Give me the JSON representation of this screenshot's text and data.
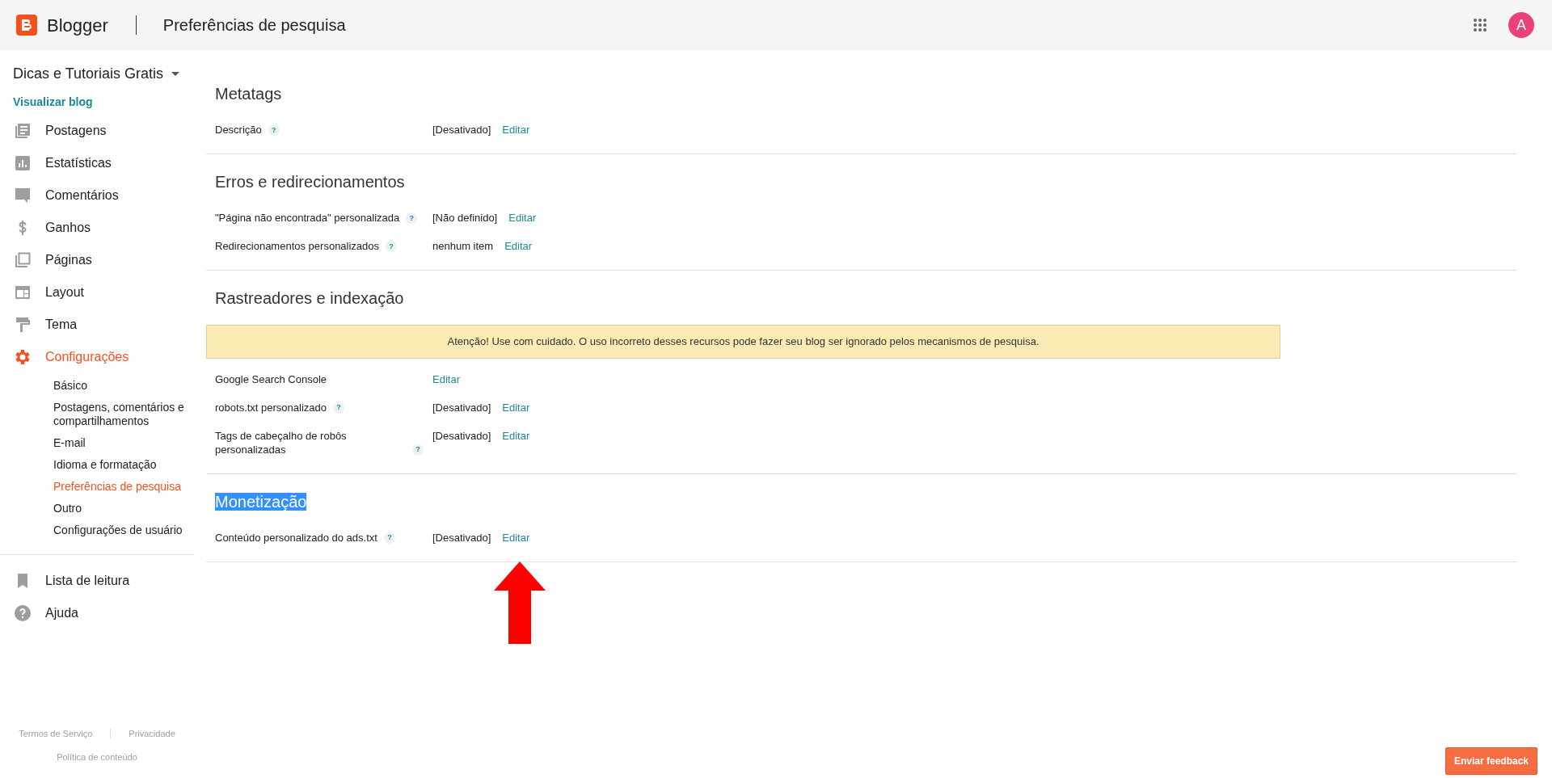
{
  "header": {
    "app_name": "Blogger",
    "page_title": "Preferências de pesquisa",
    "avatar_letter": "A"
  },
  "sidebar": {
    "blog_name": "Dicas e Tutoriais Gratis",
    "view_blog": "Visualizar blog",
    "items": [
      {
        "label": "Postagens",
        "selected": false
      },
      {
        "label": "Estatísticas",
        "selected": false
      },
      {
        "label": "Comentários",
        "selected": false
      },
      {
        "label": "Ganhos",
        "selected": false
      },
      {
        "label": "Páginas",
        "selected": false
      },
      {
        "label": "Layout",
        "selected": false
      },
      {
        "label": "Tema",
        "selected": false
      },
      {
        "label": "Configurações",
        "selected": true,
        "children": [
          {
            "label": "Básico",
            "selected": false
          },
          {
            "label": "Postagens, comentários e compartilhamentos",
            "selected": false
          },
          {
            "label": "E-mail",
            "selected": false
          },
          {
            "label": "Idioma e formatação",
            "selected": false
          },
          {
            "label": "Preferências de pesquisa",
            "selected": true
          },
          {
            "label": "Outro",
            "selected": false
          },
          {
            "label": "Configurações de usuário",
            "selected": false
          }
        ]
      }
    ],
    "bottom_items": [
      {
        "label": "Lista de leitura",
        "selected": false
      },
      {
        "label": "Ajuda",
        "selected": false
      }
    ],
    "footer_links": [
      "Termos de Serviço",
      "Privacidade",
      "Política de conteúdo"
    ]
  },
  "sections": [
    {
      "title": "Metatags",
      "highlighted": false,
      "rows": [
        {
          "label": "Descrição",
          "help": "?",
          "value": "[Desativado]",
          "action": "Editar"
        }
      ]
    },
    {
      "title": "Erros e redirecionamentos",
      "highlighted": false,
      "rows": [
        {
          "label": "\"Página não encontrada\" personalizada",
          "help": "?",
          "value": "[Não definido]",
          "action": "Editar"
        },
        {
          "label": "Redirecionamentos personalizados",
          "help": "?",
          "value": "nenhum item",
          "action": "Editar"
        }
      ]
    },
    {
      "title": "Rastreadores e indexação",
      "highlighted": false,
      "warning": "Atenção! Use com cuidado. O uso incorreto desses recursos pode fazer seu blog ser ignorado pelos mecanismos de pesquisa.",
      "rows": [
        {
          "label": "Google Search Console",
          "action": "Editar"
        },
        {
          "label": "robots.txt personalizado",
          "help": "?",
          "value": "[Desativado]",
          "action": "Editar"
        },
        {
          "label": "Tags de cabeçalho de robôs personalizadas",
          "help": "?",
          "value": "[Desativado]",
          "action": "Editar"
        }
      ]
    },
    {
      "title": "Monetização",
      "highlighted": true,
      "rows": [
        {
          "label": "Conteúdo personalizado do ads.txt",
          "help": "?",
          "value": "[Desativado]",
          "action": "Editar",
          "pointed": true
        }
      ]
    }
  ],
  "feedback_button": "Enviar feedback"
}
